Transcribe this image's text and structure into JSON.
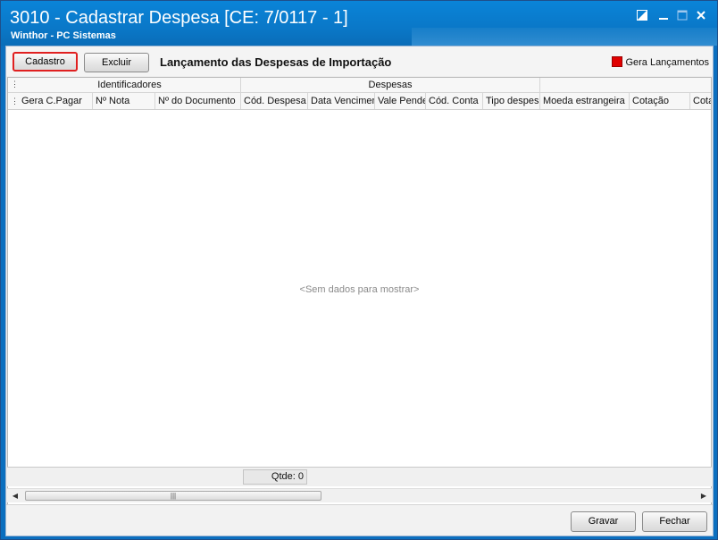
{
  "window": {
    "title": "3010 - Cadastrar Despesa [CE: 7/0117 - 1]",
    "subtitle": "Winthor - PC Sistemas",
    "controls": [
      "restore-icon",
      "minimize-icon",
      "maximize-icon",
      "close-icon"
    ]
  },
  "toolbar": {
    "cadastro_label": "Cadastro",
    "excluir_label": "Excluir",
    "heading": "Lançamento das Despesas de Importação",
    "legend_label": "Gera Lançamentos",
    "legend_color": "#e00000"
  },
  "grid": {
    "bands": [
      "Identificadores",
      "Despesas",
      ""
    ],
    "columns": [
      "Gera C.Pagar",
      "Nº Nota",
      "Nº do Documento",
      "Cód. Despesa",
      "Data Vencimento",
      "Vale Pendente",
      "Cód. Conta",
      "Tipo despesa",
      "Moeda estrangeira",
      "Cotação",
      "Cotação"
    ],
    "empty_text": "<Sem dados para mostrar>",
    "summary_qtde": "Qtde: 0"
  },
  "footer": {
    "gravar_label": "Gravar",
    "fechar_label": "Fechar"
  }
}
